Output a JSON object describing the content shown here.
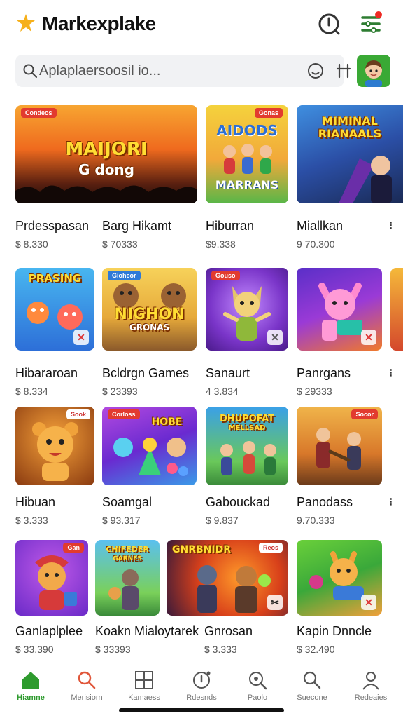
{
  "header": {
    "title": "Markexplake",
    "logo_icon": "star-logo-icon",
    "help_icon": "help-icon",
    "menu_icon": "menu-filter-icon",
    "notification_color": "#ee2a24"
  },
  "search": {
    "placeholder": "Aplaplaersoosil io...",
    "icons": [
      "search-icon",
      "face-icon",
      "filter-icon"
    ]
  },
  "colors": {
    "accent": "#2e9b2e",
    "badge": "#e23b2f"
  },
  "rows": [
    {
      "items": [
        {
          "name": "Prdesspasan",
          "price": "$ 8.330",
          "art_title": "MAIJORI",
          "art_sub": "G dong"
        },
        {
          "name": "Barg Hikamt",
          "price": "$ 70333",
          "art_title": "",
          "art_sub": ""
        },
        {
          "name": "Hiburran",
          "price": "$9.338",
          "art_title": "AIDODS",
          "art_sub": "MARRANS"
        },
        {
          "name": "Miallkan",
          "price": "9 70.300",
          "art_title": "MIMINAL RIANAALS",
          "art_sub": ""
        }
      ]
    },
    {
      "items": [
        {
          "name": "Hibararoan",
          "price": "$ 8.334",
          "art_title": "PRASING",
          "art_sub": ""
        },
        {
          "name": "Bcldrgn Games",
          "price": "$ 23393",
          "art_title": "NIGHON",
          "art_sub": "GRONAS"
        },
        {
          "name": "Sanaurt",
          "price": "4 3.834",
          "art_title": "",
          "art_sub": ""
        },
        {
          "name": "Panrgans",
          "price": "$ 29333",
          "art_title": "",
          "art_sub": ""
        }
      ]
    },
    {
      "items": [
        {
          "name": "Hibuan",
          "price": "$ 3.333",
          "art_title": "",
          "art_sub": ""
        },
        {
          "name": "Soamgal",
          "price": "$ 93.317",
          "art_title": "HOBE",
          "art_sub": ""
        },
        {
          "name": "Gabouckad",
          "price": "$ 9.837",
          "art_title": "DHUPOFAT",
          "art_sub": "MELLSAD"
        },
        {
          "name": "Panodass",
          "price": "9.70.333",
          "art_title": "",
          "art_sub": ""
        }
      ]
    },
    {
      "items": [
        {
          "name": "Ganlaplplee",
          "price": "$ 33.390",
          "art_title": "",
          "art_sub": ""
        },
        {
          "name": "Koakn Mialoytarek",
          "price": "$ 33393",
          "art_title": "CHIFEDER",
          "art_sub": "GARNES"
        },
        {
          "name": "Gnrosan",
          "price": "$ 3.333",
          "art_title": "GNRBNIDR",
          "art_sub": ""
        },
        {
          "name": "Kapin Dnncle",
          "price": "$ 32.490",
          "art_title": "",
          "art_sub": ""
        }
      ]
    }
  ],
  "bottom_nav": [
    {
      "label": "Hiamne",
      "icon": "home-icon",
      "active": true
    },
    {
      "label": "Merisiorn",
      "icon": "search-icon",
      "active": false
    },
    {
      "label": "Kamaess",
      "icon": "grid-icon",
      "active": false
    },
    {
      "label": "Rdesnds",
      "icon": "info-icon",
      "active": false
    },
    {
      "label": "Paolo",
      "icon": "zoom-icon",
      "active": false
    },
    {
      "label": "Suecone",
      "icon": "search-icon",
      "active": false
    },
    {
      "label": "Redeaies",
      "icon": "profile-icon",
      "active": false
    }
  ]
}
